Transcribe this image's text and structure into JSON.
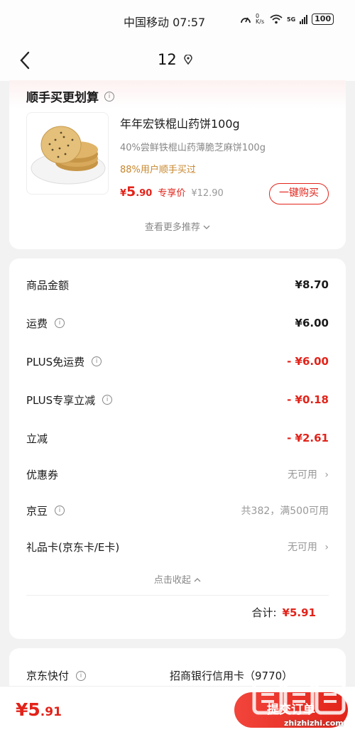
{
  "status_bar": {
    "carrier_time": "中国移动 07:57",
    "net_speed": "0 K/s",
    "network": "5G",
    "battery": "100"
  },
  "nav": {
    "back_icon": "chevron-left-icon",
    "title": "12",
    "location_icon": "location-pin-icon"
  },
  "recommend": {
    "title": "顺手买更划算",
    "product_name": "年年宏铁棍山药饼100g",
    "product_sub": "40%尝鲜铁棍山药薄脆芝麻饼100g",
    "tag": "88%用户顺手买过",
    "price_symbol": "¥",
    "price_int": "5",
    "price_dec": ".90",
    "price_label": "专享价",
    "price_orig": "¥12.90",
    "buy_button": "一键购买",
    "more": "查看更多推荐"
  },
  "summary": {
    "rows": [
      {
        "label": "商品金额",
        "value": "¥8.70",
        "info": false
      },
      {
        "label": "运费",
        "value": "¥6.00",
        "info": true
      },
      {
        "label": "PLUS免运费",
        "value": "- ¥6.00",
        "info": true
      },
      {
        "label": "PLUS专享立减",
        "value": "- ¥0.18",
        "info": true
      },
      {
        "label": "立减",
        "value": "- ¥2.61",
        "info": false
      },
      {
        "label": "优惠券",
        "value": "无可用",
        "info": false
      },
      {
        "label": "京豆",
        "value": "共382，满500可用",
        "info": true
      },
      {
        "label": "礼品卡(京东卡/E卡)",
        "value": "无可用",
        "info": false
      }
    ],
    "collapse": "点击收起",
    "total_label": "合计:",
    "total_amount": "¥5.91"
  },
  "payment": {
    "label": "京东快付",
    "value": "招商银行信用卡（9770）"
  },
  "bottom": {
    "price_int": "¥5",
    "price_dec": ".91",
    "submit": "提交订单"
  },
  "watermark": {
    "text": "zhizhizhi.com",
    "logo": "值值值"
  },
  "colors": {
    "accent": "#e2231a",
    "tag": "#c7862c",
    "background": "#f2f2f2"
  }
}
